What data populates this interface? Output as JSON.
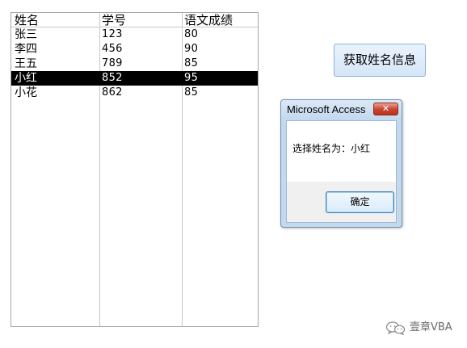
{
  "listbox": {
    "headers": [
      "姓名",
      "学号",
      "语文成绩"
    ],
    "rows": [
      {
        "name": "张三",
        "id": "123",
        "score": "80"
      },
      {
        "name": "李四",
        "id": "456",
        "score": "90"
      },
      {
        "name": "王五",
        "id": "789",
        "score": "85"
      },
      {
        "name": "小红",
        "id": "852",
        "score": "95",
        "selected": true
      },
      {
        "name": "小花",
        "id": "862",
        "score": "85"
      }
    ]
  },
  "form": {
    "get_name_button_label": "获取姓名信息"
  },
  "msgbox": {
    "title": "Microsoft Access",
    "message": "选择姓名为：小红",
    "ok_label": "确定",
    "close_symbol": "✕",
    "close_color": "#c8422c"
  },
  "watermark": {
    "icon": "wechat-icon",
    "text": "壹章VBA"
  },
  "colors": {
    "selected_row_bg": "#000000",
    "selected_row_fg": "#ffffff",
    "button_border": "#8eb1d6"
  }
}
